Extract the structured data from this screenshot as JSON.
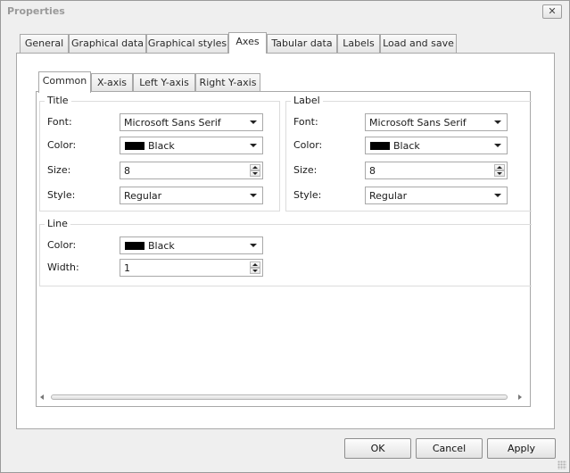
{
  "window": {
    "title": "Properties",
    "close_glyph": "✕",
    "close_icon": "close-icon"
  },
  "main_tabs": [
    {
      "label": "General"
    },
    {
      "label": "Graphical data"
    },
    {
      "label": "Graphical styles"
    },
    {
      "label": "Axes"
    },
    {
      "label": "Tabular data"
    },
    {
      "label": "Labels"
    },
    {
      "label": "Load and save"
    }
  ],
  "main_tabs_selected": "Axes",
  "axes_tabs": [
    {
      "label": "Common"
    },
    {
      "label": "X-axis"
    },
    {
      "label": "Left Y-axis"
    },
    {
      "label": "Right Y-axis"
    }
  ],
  "axes_tabs_selected": "Common",
  "title_group": {
    "legend": "Title",
    "font_label": "Font:",
    "font_value": "Microsoft Sans Serif",
    "color_label": "Color:",
    "color_value": "Black",
    "color_hex": "#000000",
    "size_label": "Size:",
    "size_value": "8",
    "style_label": "Style:",
    "style_value": "Regular"
  },
  "label_group": {
    "legend": "Label",
    "font_label": "Font:",
    "font_value": "Microsoft Sans Serif",
    "color_label": "Color:",
    "color_value": "Black",
    "color_hex": "#000000",
    "size_label": "Size:",
    "size_value": "8",
    "style_label": "Style:",
    "style_value": "Regular"
  },
  "line_group": {
    "legend": "Line",
    "color_label": "Color:",
    "color_value": "Black",
    "color_hex": "#000000",
    "width_label": "Width:",
    "width_value": "1"
  },
  "buttons": {
    "ok": "OK",
    "cancel": "Cancel",
    "apply": "Apply"
  }
}
